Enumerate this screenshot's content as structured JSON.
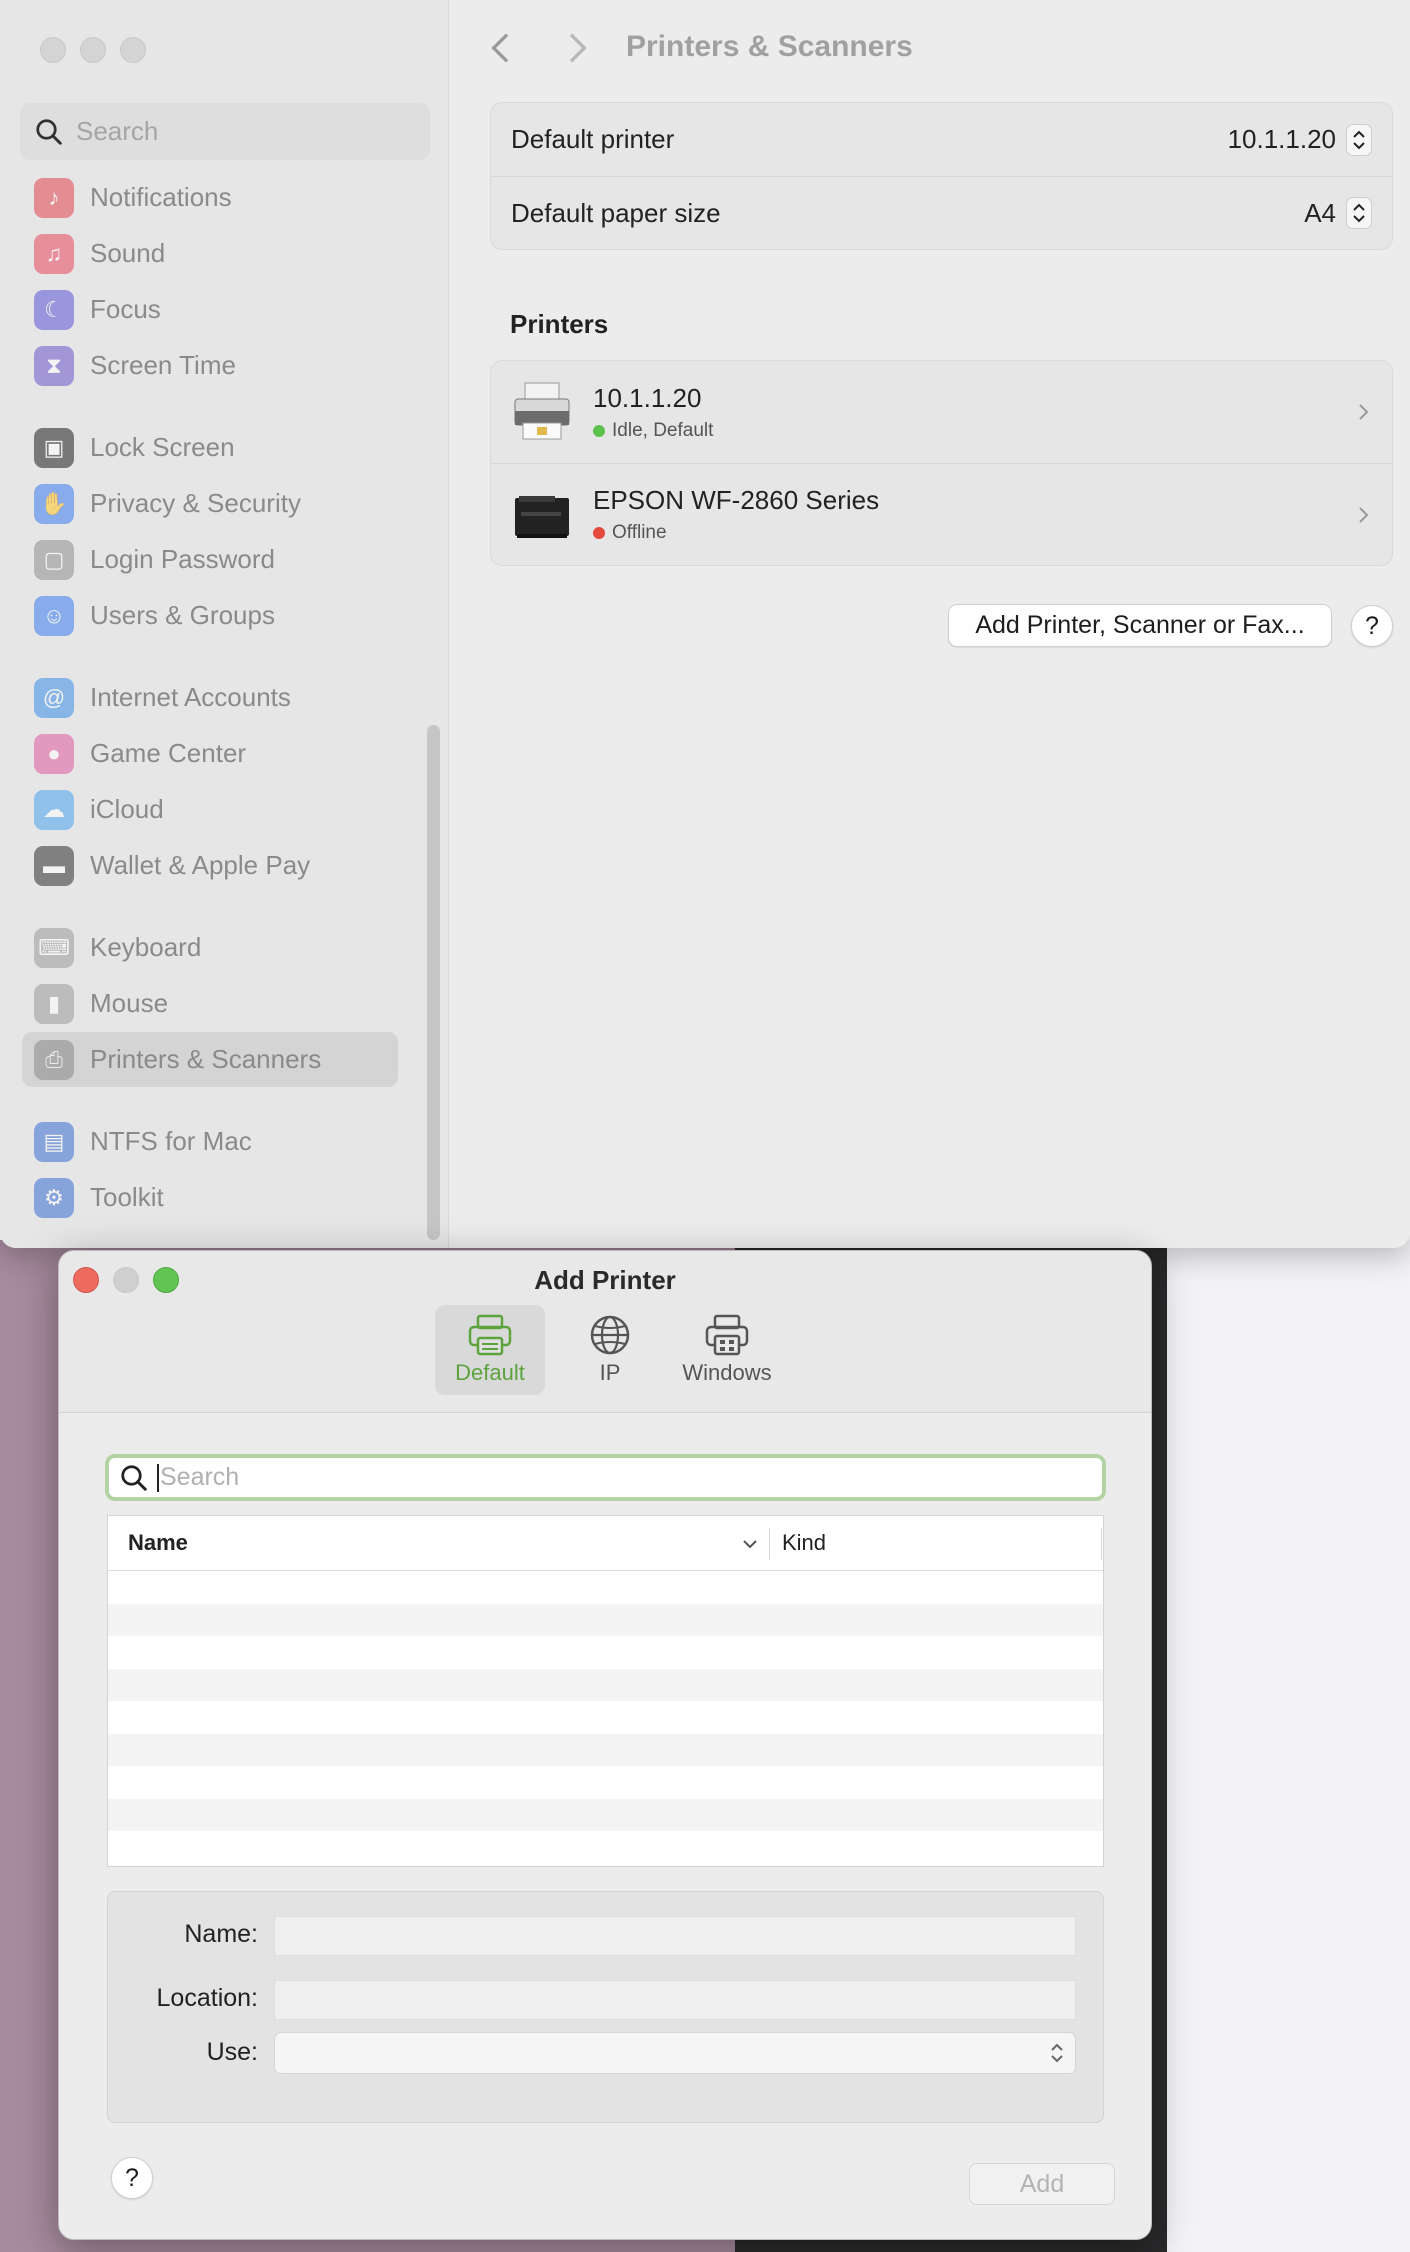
{
  "settings": {
    "search_placeholder": "Search",
    "title": "Printers & Scanners",
    "sidebar": [
      {
        "label": "Notifications",
        "icon": "bell-icon",
        "color": "#e0454f"
      },
      {
        "label": "Sound",
        "icon": "speaker-icon",
        "color": "#e8475e"
      },
      {
        "label": "Focus",
        "icon": "moon-icon",
        "color": "#5b55d6"
      },
      {
        "label": "Screen Time",
        "icon": "hourglass-icon",
        "color": "#6a56c9"
      },
      {
        "label": "Lock Screen",
        "icon": "lock-icon",
        "color": "#1f1f1f"
      },
      {
        "label": "Privacy & Security",
        "icon": "hand-icon",
        "color": "#3a7cf0"
      },
      {
        "label": "Login Password",
        "icon": "padlock-icon",
        "color": "#8f8f8f"
      },
      {
        "label": "Users & Groups",
        "icon": "users-icon",
        "color": "#3a7cf0"
      },
      {
        "label": "Internet Accounts",
        "icon": "at-icon",
        "color": "#3a8ee6"
      },
      {
        "label": "Game Center",
        "icon": "game-center-icon",
        "color": "#e05aa0"
      },
      {
        "label": "iCloud",
        "icon": "cloud-icon",
        "color": "#4aa3ef"
      },
      {
        "label": "Wallet & Apple Pay",
        "icon": "wallet-icon",
        "color": "#2e2e2e"
      },
      {
        "label": "Keyboard",
        "icon": "keyboard-icon",
        "color": "#9a9a9a"
      },
      {
        "label": "Mouse",
        "icon": "mouse-icon",
        "color": "#9a9a9a"
      },
      {
        "label": "Printers & Scanners",
        "icon": "printer-icon",
        "color": "#8a8a8a"
      },
      {
        "label": "NTFS for Mac",
        "icon": "ntfs-icon",
        "color": "#3a6fd1"
      },
      {
        "label": "Toolkit",
        "icon": "toolkit-icon",
        "color": "#3a6fd1"
      }
    ],
    "default_printer_label": "Default printer",
    "default_printer_value": "10.1.1.20",
    "default_paper_label": "Default paper size",
    "default_paper_value": "A4",
    "printers_heading": "Printers",
    "printers": [
      {
        "name": "10.1.1.20",
        "status": "Idle, Default",
        "status_color": "#5cc04a"
      },
      {
        "name": "EPSON WF-2860 Series",
        "status": "Offline",
        "status_color": "#e5483c"
      }
    ],
    "add_button": "Add Printer, Scanner or Fax...",
    "help": "?"
  },
  "add_printer": {
    "title": "Add Printer",
    "tabs": [
      {
        "label": "Default",
        "icon": "printer-icon",
        "active": true
      },
      {
        "label": "IP",
        "icon": "globe-icon",
        "active": false
      },
      {
        "label": "Windows",
        "icon": "windows-printer-icon",
        "active": false
      }
    ],
    "search_placeholder": "Search",
    "col_name": "Name",
    "col_kind": "Kind",
    "name_label": "Name:",
    "location_label": "Location:",
    "use_label": "Use:",
    "help": "?",
    "add_button": "Add"
  },
  "colors": {
    "accent_green": "#5da33d",
    "focus_ring": "#b4d3a4"
  }
}
